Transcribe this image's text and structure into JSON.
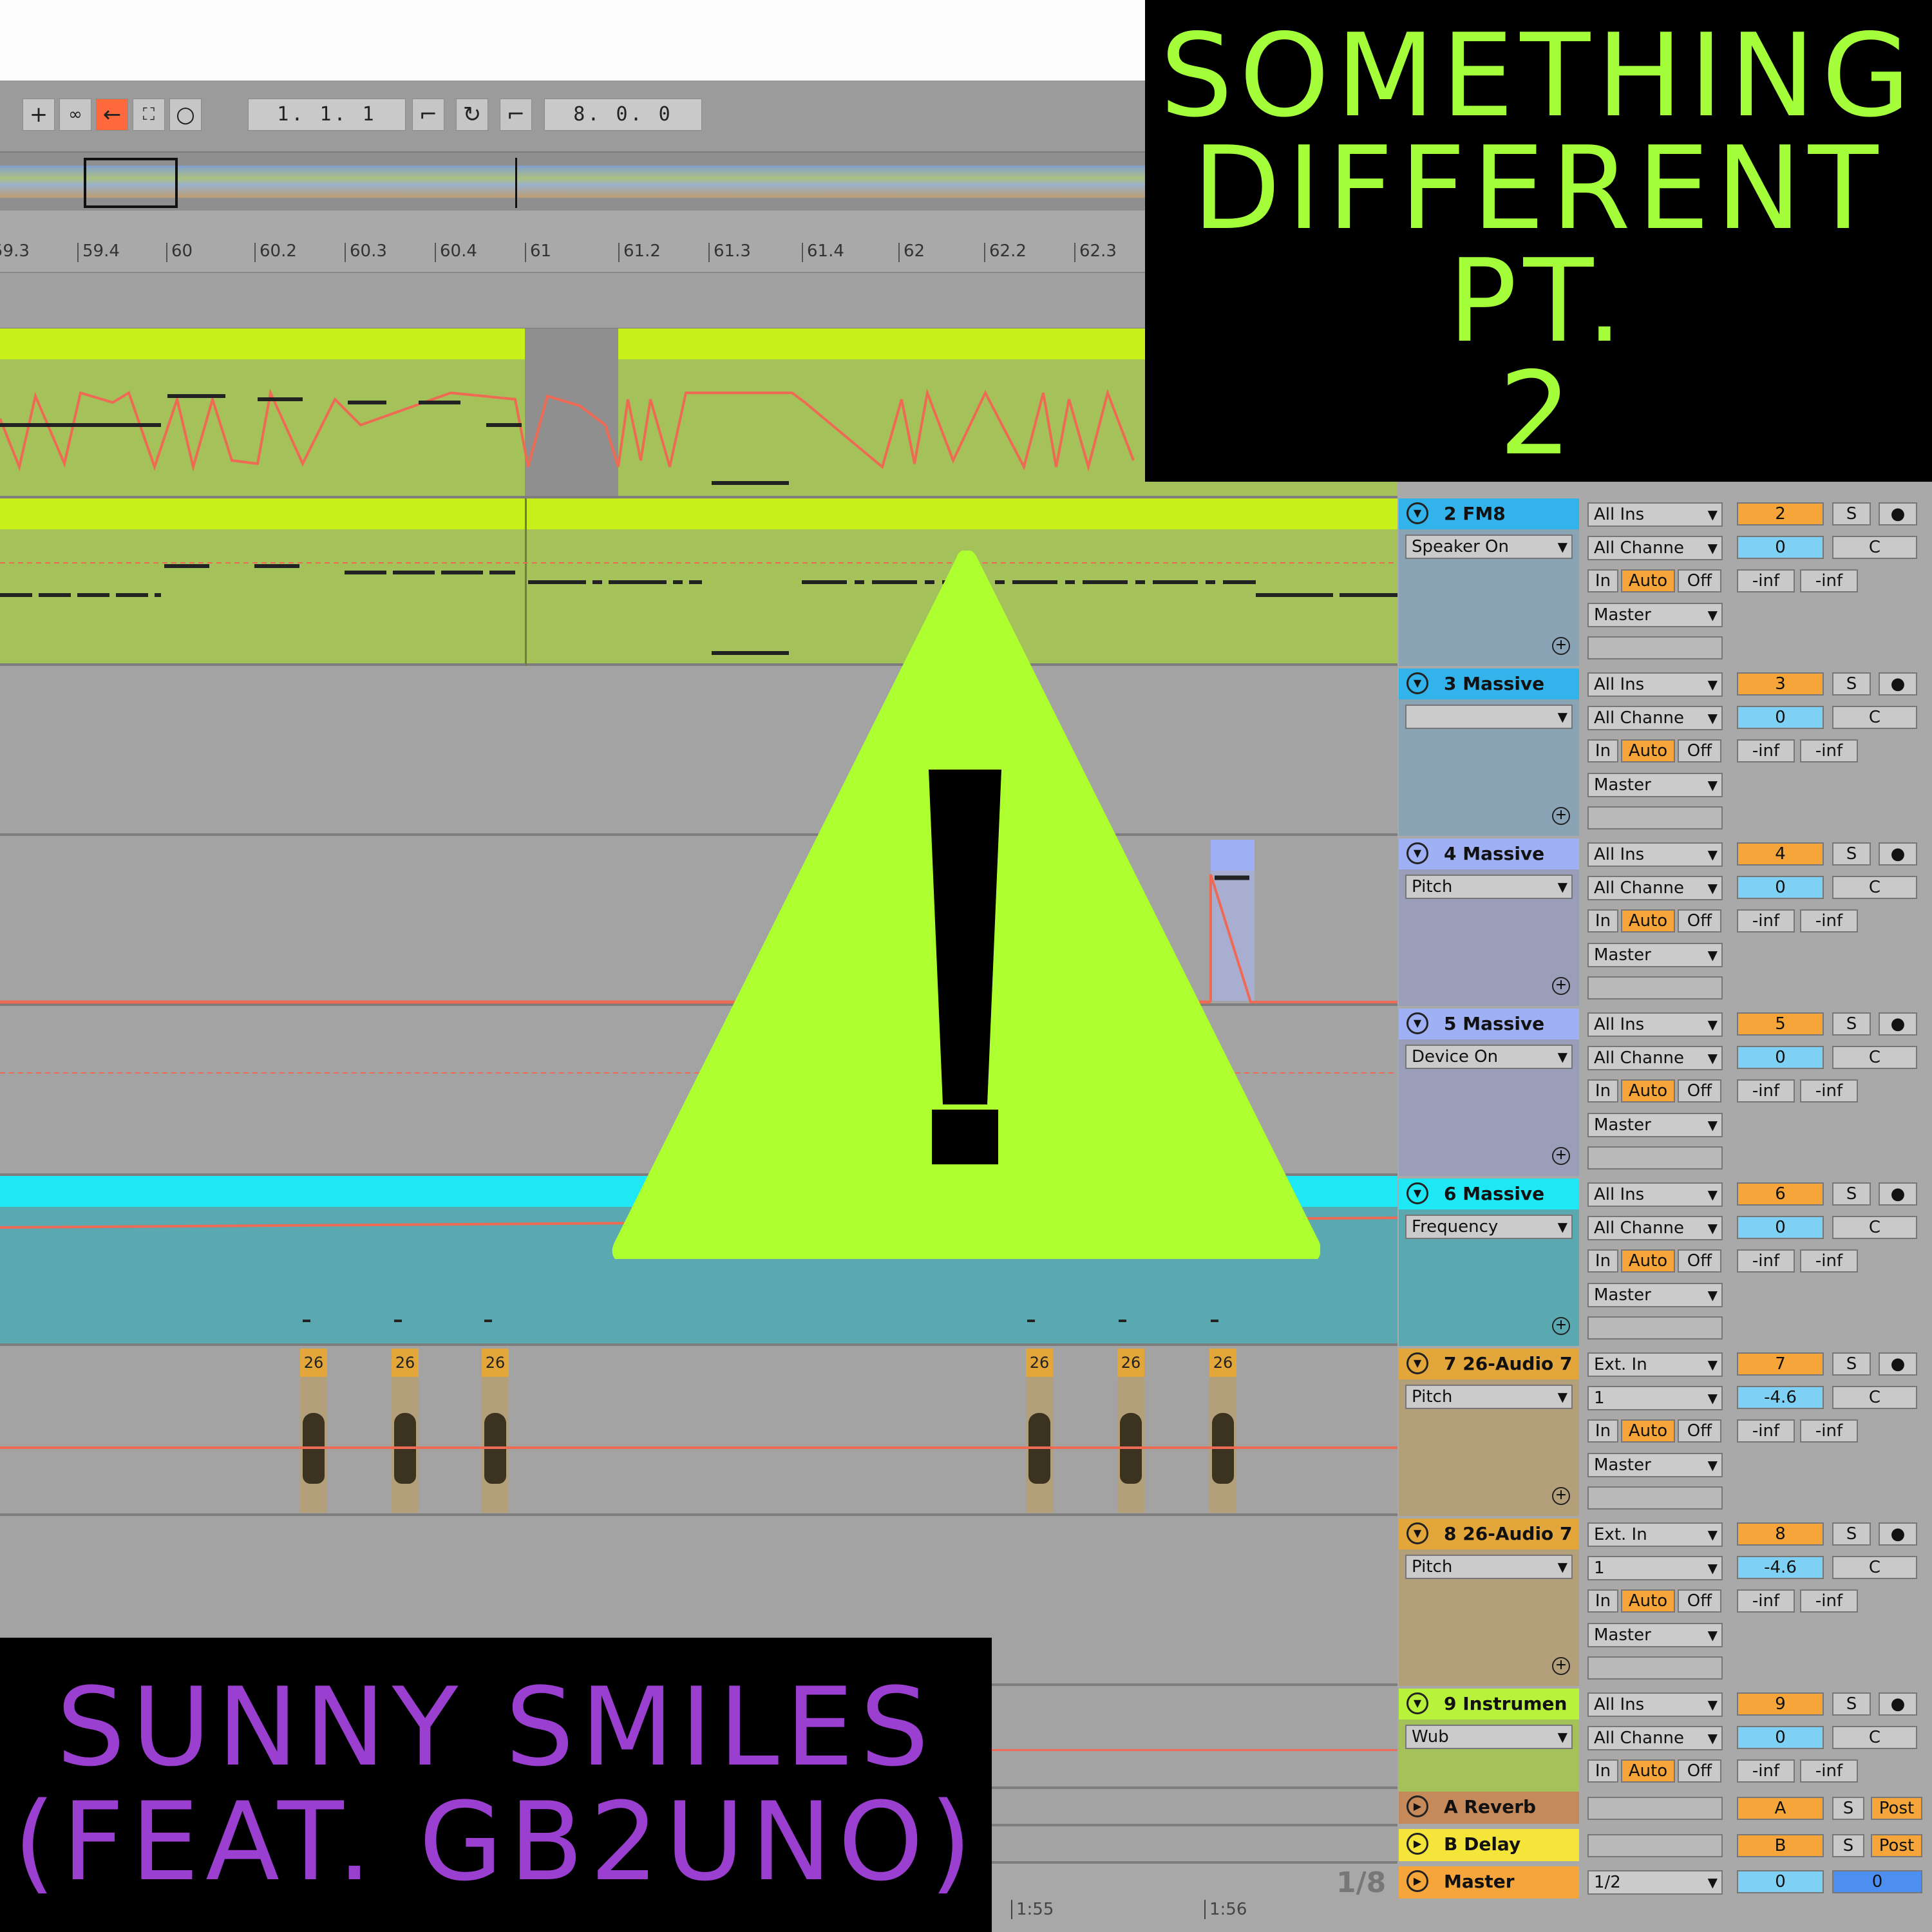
{
  "toolbar": {
    "icons": [
      "plus-icon",
      "link-icon",
      "arrow-left-icon",
      "fit-icon",
      "circle-icon"
    ],
    "position": "1.  1.  1",
    "length": "8.  0.  0"
  },
  "ruler": {
    "ticks": [
      "59.3",
      "59.4",
      "60",
      "60.2",
      "60.3",
      "60.4",
      "61",
      "61.2",
      "61.3",
      "61.4",
      "62",
      "62.2",
      "62.3"
    ]
  },
  "title_box": {
    "line1": "SOMETHING",
    "line2": "DIFFERENT",
    "line3": "PT.",
    "line4": "2",
    "color": "#a4ff3a"
  },
  "artist_box": {
    "line1": "SUNNY SMILES",
    "line2": "(FEAT. GB2UNO)",
    "color": "#9b3fd1"
  },
  "warning": {
    "symbol": "!",
    "fill": "#adff2f"
  },
  "clip_label": "26",
  "tracks": [
    {
      "name": "2 FM8",
      "param": "Speaker On",
      "input": "All Ins",
      "channel": "All Channe",
      "monitor_in": "In",
      "monitor_auto": "Auto",
      "monitor_off": "Off",
      "output": "Master",
      "number": "2",
      "vol": "0",
      "pan": "C",
      "solo": "S",
      "peak_l": "-inf",
      "peak_r": "-inf",
      "color": "#33b3ec"
    },
    {
      "name": "3 Massive",
      "param": "",
      "input": "All Ins",
      "channel": "All Channe",
      "monitor_in": "In",
      "monitor_auto": "Auto",
      "monitor_off": "Off",
      "output": "Master",
      "number": "3",
      "vol": "0",
      "pan": "C",
      "solo": "S",
      "peak_l": "-inf",
      "peak_r": "-inf",
      "color": "#33b3ec"
    },
    {
      "name": "4 Massive",
      "param": "Pitch",
      "input": "All Ins",
      "channel": "All Channe",
      "monitor_in": "In",
      "monitor_auto": "Auto",
      "monitor_off": "Off",
      "output": "Master",
      "number": "4",
      "vol": "0",
      "pan": "C",
      "solo": "S",
      "peak_l": "-inf",
      "peak_r": "-inf",
      "color": "#9fb0f5"
    },
    {
      "name": "5 Massive",
      "param": "Device On",
      "input": "All Ins",
      "channel": "All Channe",
      "monitor_in": "In",
      "monitor_auto": "Auto",
      "monitor_off": "Off",
      "output": "Master",
      "number": "5",
      "vol": "0",
      "pan": "C",
      "solo": "S",
      "peak_l": "-inf",
      "peak_r": "-inf",
      "color": "#9fb0f5"
    },
    {
      "name": "6 Massive",
      "param": "Frequency",
      "input": "All Ins",
      "channel": "All Channe",
      "monitor_in": "In",
      "monitor_auto": "Auto",
      "monitor_off": "Off",
      "output": "Master",
      "number": "6",
      "vol": "0",
      "pan": "C",
      "solo": "S",
      "peak_l": "-inf",
      "peak_r": "-inf",
      "color": "#1ee8f5"
    },
    {
      "name": "7 26-Audio 7",
      "param": "Pitch",
      "input": "Ext. In",
      "channel": "1",
      "monitor_in": "In",
      "monitor_auto": "Auto",
      "monitor_off": "Off",
      "output": "Master",
      "number": "7",
      "vol": "-4.6",
      "pan": "C",
      "solo": "S",
      "peak_l": "-inf",
      "peak_r": "-inf",
      "color": "#e3a63a"
    },
    {
      "name": "8 26-Audio 7",
      "param": "Pitch",
      "input": "Ext. In",
      "channel": "1",
      "monitor_in": "In",
      "monitor_auto": "Auto",
      "monitor_off": "Off",
      "output": "Master",
      "number": "8",
      "vol": "-4.6",
      "pan": "C",
      "solo": "S",
      "peak_l": "-inf",
      "peak_r": "-inf",
      "color": "#e3a63a"
    },
    {
      "name": "9 Instrumen",
      "param": "Wub",
      "input": "All Ins",
      "channel": "All Channe",
      "monitor_in": "In",
      "monitor_auto": "Auto",
      "monitor_off": "Off",
      "output": "",
      "number": "9",
      "vol": "0",
      "pan": "C",
      "solo": "S",
      "peak_l": "-inf",
      "peak_r": "-inf",
      "color": "#b9f23a"
    }
  ],
  "returns": [
    {
      "name": "A Reverb",
      "letter": "A",
      "solo": "S",
      "post": "Post",
      "color": "#c68a5a"
    },
    {
      "name": "B Delay",
      "letter": "B",
      "solo": "S",
      "post": "Post",
      "color": "#f5e43a"
    }
  ],
  "master": {
    "name": "Master",
    "quant": "1/2",
    "vol": "0",
    "pan": "0",
    "color": "#f5a53a"
  },
  "footer": {
    "page": "1/8",
    "time1": "1:55",
    "time2": "1:56"
  }
}
